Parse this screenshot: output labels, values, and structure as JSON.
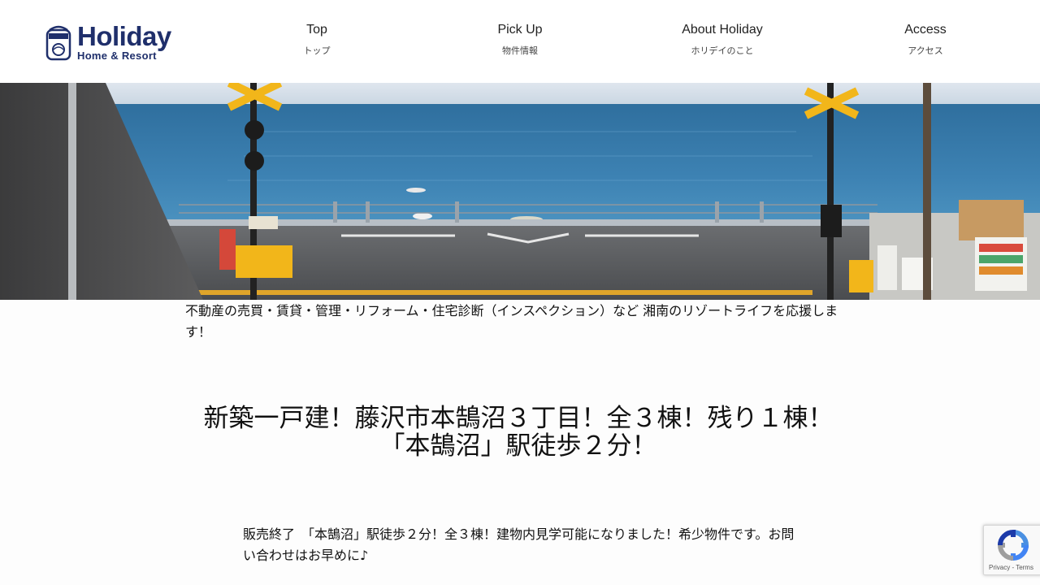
{
  "brand": {
    "name": "Holiday",
    "sub": "Home & Resort",
    "color": "#1f2f6b"
  },
  "nav": {
    "items": [
      {
        "en": "Top",
        "jp": "トップ"
      },
      {
        "en": "Pick Up",
        "jp": "物件情報"
      },
      {
        "en": "About Holiday",
        "jp": "ホリデイのこと"
      },
      {
        "en": "Access",
        "jp": "アクセス"
      }
    ]
  },
  "hero": {
    "icon": "railroad-crossing-ocean-photo"
  },
  "tagline": "不動産の売買・賃貸・管理・リフォーム・住宅診断（インスペクション）など 湘南のリゾートライフを応援します！",
  "headline": {
    "line1": "新築一戸建！藤沢市本鵠沼３丁目！全３棟！残り１棟！",
    "line2": "「本鵠沼」駅徒歩２分！"
  },
  "body": "販売終了　「本鵠沼」駅徒歩２分！全３棟！建物内見学可能になりました！希少物件です。お問い合わせはお早めに♪",
  "recaptcha": {
    "terms": "Privacy - Terms"
  }
}
